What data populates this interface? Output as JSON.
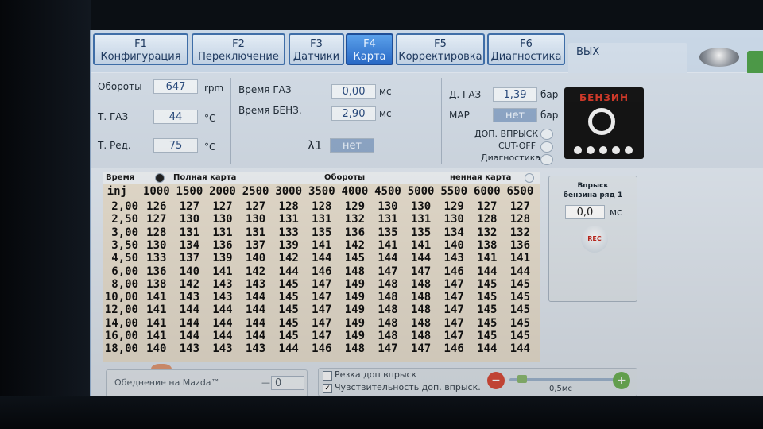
{
  "tabs": [
    {
      "key": "F1",
      "label": "Конфигурация"
    },
    {
      "key": "F2",
      "label": "Переключение"
    },
    {
      "key": "F3",
      "label": "Датчики"
    },
    {
      "key": "F4",
      "label": "Карта"
    },
    {
      "key": "F5",
      "label": "Корректировка"
    },
    {
      "key": "F6",
      "label": "Диагностика"
    },
    {
      "key": "",
      "label": "ВЫХ"
    }
  ],
  "info": {
    "rpm_label": "Обороты",
    "rpm_value": "647",
    "rpm_unit": "rpm",
    "tgas_label": "Т. ГАЗ",
    "tgas_value": "44",
    "tgas_unit": "°С",
    "tred_label": "Т. Ред.",
    "tred_value": "75",
    "tred_unit": "°С",
    "gas_time_label": "Время ГАЗ",
    "gas_time_value": "0,00",
    "gas_time_unit": "мс",
    "petrol_time_label": "Время БЕНЗ.",
    "petrol_time_value": "2,90",
    "petrol_time_unit": "мс",
    "lambda_label": "λ1",
    "lambda_value": "нет",
    "dgas_label": "Д. ГАЗ",
    "dgas_value": "1,39",
    "dgas_unit": "бар",
    "map_label": "MAP",
    "map_value": "нет",
    "map_unit": "бар",
    "opt1": "ДОП. ВПРЫСК",
    "opt2": "CUT-OFF",
    "opt3": "Диагностика",
    "benzin_label": "БЕНЗИН"
  },
  "map": {
    "time_header": "Время",
    "inj_header": "inj",
    "full_map_label": "Полная карта",
    "rpm_header": "Обороты",
    "partial_map_label": "ненная карта",
    "rpm": [
      "1000",
      "1500",
      "2000",
      "2500",
      "3000",
      "3500",
      "4000",
      "4500",
      "5000",
      "5500",
      "6000",
      "6500"
    ],
    "rows": [
      {
        "inj": "2,00",
        "v": [
          "126",
          "127",
          "127",
          "127",
          "128",
          "128",
          "129",
          "130",
          "130",
          "129",
          "127",
          "127"
        ]
      },
      {
        "inj": "2,50",
        "v": [
          "127",
          "130",
          "130",
          "130",
          "131",
          "131",
          "132",
          "131",
          "131",
          "130",
          "128",
          "128"
        ]
      },
      {
        "inj": "3,00",
        "v": [
          "128",
          "131",
          "131",
          "131",
          "133",
          "135",
          "136",
          "135",
          "135",
          "134",
          "132",
          "132"
        ]
      },
      {
        "inj": "3,50",
        "v": [
          "130",
          "134",
          "136",
          "137",
          "139",
          "141",
          "142",
          "141",
          "141",
          "140",
          "138",
          "136"
        ]
      },
      {
        "inj": "4,50",
        "v": [
          "133",
          "137",
          "139",
          "140",
          "142",
          "144",
          "145",
          "144",
          "144",
          "143",
          "141",
          "141"
        ]
      },
      {
        "inj": "6,00",
        "v": [
          "136",
          "140",
          "141",
          "142",
          "144",
          "146",
          "148",
          "147",
          "147",
          "146",
          "144",
          "144"
        ]
      },
      {
        "inj": "8,00",
        "v": [
          "138",
          "142",
          "143",
          "143",
          "145",
          "147",
          "149",
          "148",
          "148",
          "147",
          "145",
          "145"
        ]
      },
      {
        "inj": "10,00",
        "v": [
          "141",
          "143",
          "143",
          "144",
          "145",
          "147",
          "149",
          "148",
          "148",
          "147",
          "145",
          "145"
        ]
      },
      {
        "inj": "12,00",
        "v": [
          "141",
          "144",
          "144",
          "144",
          "145",
          "147",
          "149",
          "148",
          "148",
          "147",
          "145",
          "145"
        ]
      },
      {
        "inj": "14,00",
        "v": [
          "141",
          "144",
          "144",
          "144",
          "145",
          "147",
          "149",
          "148",
          "148",
          "147",
          "145",
          "145"
        ]
      },
      {
        "inj": "16,00",
        "v": [
          "141",
          "144",
          "144",
          "144",
          "145",
          "147",
          "149",
          "148",
          "148",
          "147",
          "145",
          "145"
        ]
      },
      {
        "inj": "18,00",
        "v": [
          "140",
          "143",
          "143",
          "143",
          "144",
          "146",
          "148",
          "147",
          "147",
          "146",
          "144",
          "144"
        ]
      }
    ]
  },
  "injection": {
    "title": "Впрыск бензина ряд 1",
    "value": "0,0",
    "unit": "мс",
    "rec_label": "REC"
  },
  "bottom": {
    "lean_label": "Обеднение на Mazda™",
    "lean_dash": "—",
    "lean_value": "0",
    "cut_label": "Резка доп впрыск",
    "sens_label": "Чувствительность доп. впрыск.",
    "sens_value": "0,5мс",
    "minus": "−",
    "plus": "+"
  }
}
